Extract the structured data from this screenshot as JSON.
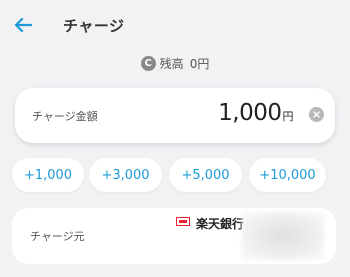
{
  "header": {
    "title": "チャージ",
    "back_icon": "arrow-left-icon",
    "accent": "#1e9bd7"
  },
  "balance": {
    "icon_letter": "C",
    "label": "残高",
    "amount": "0円"
  },
  "amount_card": {
    "label": "チャージ金額",
    "value": "1,000",
    "unit": "円",
    "clear_icon": "clear-circle-icon"
  },
  "quick_amounts": [
    "+1,000",
    "+3,000",
    "+5,000",
    "+10,000"
  ],
  "source": {
    "label": "チャージ元",
    "bank_name": "楽天銀行"
  }
}
